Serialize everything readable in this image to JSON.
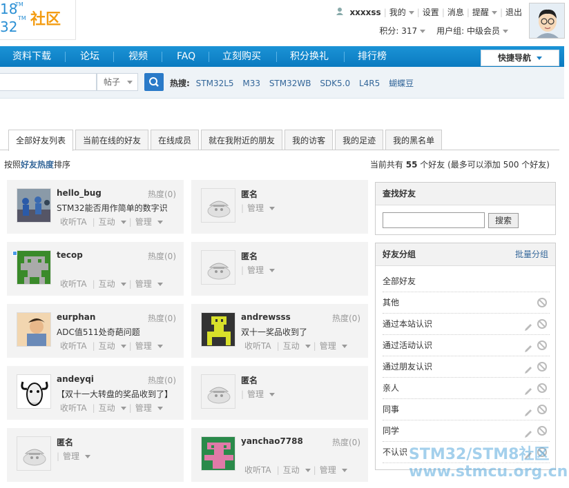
{
  "logo": {
    "num_top": "18",
    "num_bottom": "32",
    "tm": "TM",
    "text": "社区"
  },
  "user": {
    "username": "xxxxss",
    "links": [
      "我的",
      "设置",
      "消息",
      "提醒",
      "退出"
    ],
    "points": "积分: 317",
    "group": "用户组: 中级会员"
  },
  "nav": {
    "items": [
      "资料下载",
      "论坛",
      "视频",
      "FAQ",
      "立刻购买",
      "积分换礼",
      "排行榜"
    ],
    "quick": "快捷导航"
  },
  "search": {
    "type": "帖子",
    "hot_label": "热搜:",
    "hot": [
      "STM32L5",
      "M33",
      "STM32WB",
      "SDK5.0",
      "L4R5",
      "蝴蝶豆"
    ]
  },
  "tabs": [
    "全部好友列表",
    "当前在线的好友",
    "在线成员",
    "就在我附近的朋友",
    "我的访客",
    "我的足迹",
    "我的黑名单"
  ],
  "sort": {
    "pre": "按照",
    "key": "好友热度",
    "post": "排序"
  },
  "count": {
    "pre": "当前共有",
    "num": "55",
    "post": "个好友 (最多可以添加 500 个好友)"
  },
  "friends": [
    {
      "name": "hello_bug",
      "heat": "热度(0)",
      "sig": "STM32能否用作简单的数字识",
      "acts": [
        "收听TA",
        "互动",
        "管理"
      ],
      "avatar": "photo"
    },
    {
      "name": "匿名",
      "heat": "",
      "sig": "",
      "acts": [
        "管理"
      ],
      "avatar": "anon"
    },
    {
      "name": "tecop",
      "heat": "热度(0)",
      "sig": "",
      "acts": [
        "收听TA",
        "互动",
        "管理"
      ],
      "avatar": "green"
    },
    {
      "name": "匿名",
      "heat": "",
      "sig": "",
      "acts": [
        "管理"
      ],
      "avatar": "anon"
    },
    {
      "name": "eurphan",
      "heat": "热度(0)",
      "sig": "ADC值511处奇葩问题",
      "acts": [
        "收听TA",
        "互动",
        "管理"
      ],
      "avatar": "photo2"
    },
    {
      "name": "andrewsss",
      "heat": "热度(0)",
      "sig": "双十一奖品收到了",
      "acts": [
        "收听TA",
        "互动",
        "管理"
      ],
      "avatar": "yellow"
    },
    {
      "name": "andeyqi",
      "heat": "热度(0)",
      "sig": "【双十一大转盘的奖品收到了】",
      "acts": [
        "收听TA",
        "互动",
        "管理"
      ],
      "avatar": "gnu"
    },
    {
      "name": "匿名",
      "heat": "",
      "sig": "",
      "acts": [
        "管理"
      ],
      "avatar": "anon"
    },
    {
      "name": "匿名",
      "heat": "",
      "sig": "",
      "acts": [
        "管理"
      ],
      "avatar": "anon"
    },
    {
      "name": "yanchao7788",
      "heat": "热度(0)",
      "sig": "",
      "acts": [
        "收听TA",
        "互动",
        "管理"
      ],
      "avatar": "pink"
    }
  ],
  "find": {
    "title": "查找好友",
    "button": "搜索"
  },
  "groups": {
    "title": "好友分组",
    "batch": "批量分组",
    "items": [
      "全部好友",
      "其他",
      "通过本站认识",
      "通过活动认识",
      "通过朋友认识",
      "亲人",
      "同事",
      "同学",
      "不认识"
    ]
  },
  "watermark": {
    "line1": "STM32/STM8社区",
    "line2": "www.stmcu.org.cn"
  }
}
